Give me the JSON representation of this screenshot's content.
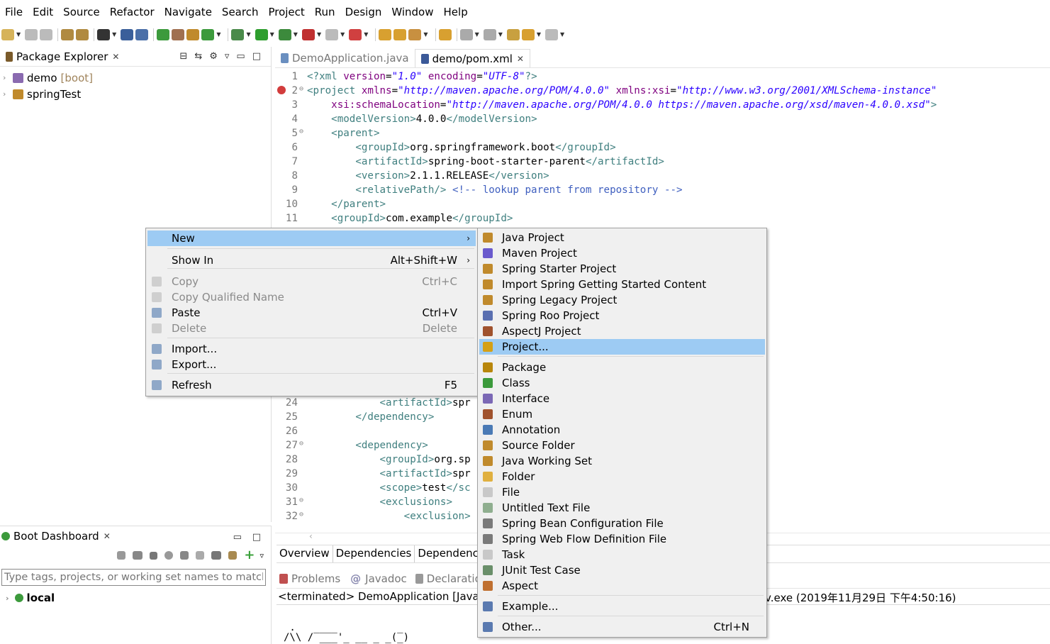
{
  "menubar": [
    "File",
    "Edit",
    "Source",
    "Refactor",
    "Navigate",
    "Search",
    "Project",
    "Run",
    "Design",
    "Window",
    "Help"
  ],
  "package_explorer": {
    "title": "Package Explorer",
    "items": [
      {
        "name": "demo",
        "tag": "[boot]"
      },
      {
        "name": "springTest",
        "tag": ""
      }
    ]
  },
  "editor": {
    "tabs": [
      "DemoApplication.java",
      "demo/pom.xml"
    ],
    "bottom_tabs": [
      "Overview",
      "Dependencies",
      "Dependency"
    ],
    "lines_top": [
      {
        "n": "1",
        "segs": [
          [
            "t",
            "<?xml "
          ],
          [
            "a",
            "version"
          ],
          [
            "p",
            "="
          ],
          [
            "v",
            "\"1.0\""
          ],
          [
            "p",
            " "
          ],
          [
            "a",
            "encoding"
          ],
          [
            "p",
            "="
          ],
          [
            "v",
            "\"UTF-8\""
          ],
          [
            "t",
            "?>"
          ]
        ]
      },
      {
        "n": "2",
        "segs": [
          [
            "t",
            "<project "
          ],
          [
            "a",
            "xmlns"
          ],
          [
            "p",
            "="
          ],
          [
            "v",
            "\"http://maven.apache.org/POM/4.0.0\""
          ],
          [
            "p",
            " "
          ],
          [
            "a",
            "xmlns:xsi"
          ],
          [
            "p",
            "="
          ],
          [
            "v",
            "\"http://www.w3.org/2001/XMLSchema-instance\""
          ]
        ]
      },
      {
        "n": "3",
        "segs": [
          [
            "p",
            "    "
          ],
          [
            "a",
            "xsi:schemaLocation"
          ],
          [
            "p",
            "="
          ],
          [
            "v",
            "\"http://maven.apache.org/POM/4.0.0 https://maven.apache.org/xsd/maven-4.0.0.xsd\""
          ],
          [
            "t",
            ">"
          ]
        ]
      },
      {
        "n": "4",
        "segs": [
          [
            "p",
            "    "
          ],
          [
            "t",
            "<modelVersion>"
          ],
          [
            "p",
            "4.0.0"
          ],
          [
            "t",
            "</modelVersion>"
          ]
        ]
      },
      {
        "n": "5",
        "segs": [
          [
            "p",
            "    "
          ],
          [
            "t",
            "<parent>"
          ]
        ]
      },
      {
        "n": "6",
        "segs": [
          [
            "p",
            "        "
          ],
          [
            "t",
            "<groupId>"
          ],
          [
            "p",
            "org.springframework.boot"
          ],
          [
            "t",
            "</groupId>"
          ]
        ]
      },
      {
        "n": "7",
        "segs": [
          [
            "p",
            "        "
          ],
          [
            "t",
            "<artifactId>"
          ],
          [
            "p",
            "spring-boot-starter-parent"
          ],
          [
            "t",
            "</artifactId>"
          ]
        ]
      },
      {
        "n": "8",
        "segs": [
          [
            "p",
            "        "
          ],
          [
            "t",
            "<version>"
          ],
          [
            "p",
            "2.1.1.RELEASE"
          ],
          [
            "t",
            "</version>"
          ]
        ]
      },
      {
        "n": "9",
        "segs": [
          [
            "p",
            "        "
          ],
          [
            "t",
            "<relativePath/>"
          ],
          [
            "p",
            " "
          ],
          [
            "c",
            "<!-- lookup parent from repository -->"
          ]
        ]
      },
      {
        "n": "10",
        "segs": [
          [
            "p",
            "    "
          ],
          [
            "t",
            "</parent>"
          ]
        ]
      },
      {
        "n": "11",
        "segs": [
          [
            "p",
            "    "
          ],
          [
            "t",
            "<groupId>"
          ],
          [
            "p",
            "com.example"
          ],
          [
            "t",
            "</groupId>"
          ]
        ]
      }
    ],
    "lines_bottom": [
      {
        "n": "24",
        "segs": [
          [
            "p",
            "            "
          ],
          [
            "t",
            "<artifactId>"
          ],
          [
            "p",
            "spr"
          ]
        ]
      },
      {
        "n": "25",
        "segs": [
          [
            "p",
            "        "
          ],
          [
            "t",
            "</dependency>"
          ]
        ]
      },
      {
        "n": "26",
        "segs": []
      },
      {
        "n": "27",
        "segs": [
          [
            "p",
            "        "
          ],
          [
            "t",
            "<dependency>"
          ]
        ]
      },
      {
        "n": "28",
        "segs": [
          [
            "p",
            "            "
          ],
          [
            "t",
            "<groupId>"
          ],
          [
            "p",
            "org.sp"
          ]
        ]
      },
      {
        "n": "29",
        "segs": [
          [
            "p",
            "            "
          ],
          [
            "t",
            "<artifactId>"
          ],
          [
            "p",
            "spr"
          ]
        ]
      },
      {
        "n": "30",
        "segs": [
          [
            "p",
            "            "
          ],
          [
            "t",
            "<scope>"
          ],
          [
            "p",
            "test"
          ],
          [
            "t",
            "</sc"
          ]
        ]
      },
      {
        "n": "31",
        "segs": [
          [
            "p",
            "            "
          ],
          [
            "t",
            "<exclusions>"
          ]
        ]
      },
      {
        "n": "32",
        "segs": [
          [
            "p",
            "                "
          ],
          [
            "t",
            "<exclusion>"
          ]
        ]
      }
    ]
  },
  "boot_dashboard": {
    "title": "Boot Dashboard",
    "filter_placeholder": "Type tags, projects, or working set names to match",
    "local_label": "local"
  },
  "console": {
    "tabs": [
      "Problems",
      "Javadoc",
      "Declaratio"
    ],
    "terminated_left": "<terminated> DemoApplication [Java A",
    "terminated_right": "v.exe (2019年11月29日 下午4:50:16)"
  },
  "context_menu": {
    "items": [
      {
        "label": "New",
        "accel": "",
        "submenu": true,
        "selected": true,
        "disabled": false,
        "icon": ""
      },
      {
        "label": "Show In",
        "accel": "Alt+Shift+W",
        "submenu": true,
        "selected": false,
        "disabled": false,
        "icon": ""
      },
      {
        "label": "Copy",
        "accel": "Ctrl+C",
        "disabled": true,
        "icon": "copy-icon"
      },
      {
        "label": "Copy Qualified Name",
        "accel": "",
        "disabled": true,
        "icon": "copy-qualified-name-icon"
      },
      {
        "label": "Paste",
        "accel": "Ctrl+V",
        "disabled": false,
        "icon": "paste-icon"
      },
      {
        "label": "Delete",
        "accel": "Delete",
        "disabled": true,
        "icon": "delete-icon"
      },
      {
        "label": "Import...",
        "accel": "",
        "disabled": false,
        "icon": "import-icon"
      },
      {
        "label": "Export...",
        "accel": "",
        "disabled": false,
        "icon": "export-icon"
      },
      {
        "label": "Refresh",
        "accel": "F5",
        "disabled": false,
        "icon": "refresh-icon"
      }
    ]
  },
  "new_submenu": {
    "items": [
      {
        "label": "Java Project",
        "icon": "java-project-icon",
        "color": "#c08a2c"
      },
      {
        "label": "Maven Project",
        "icon": "maven-project-icon",
        "color": "#6a5acd"
      },
      {
        "label": "Spring Starter Project",
        "icon": "spring-starter-icon",
        "color": "#c08a2c"
      },
      {
        "label": "Import Spring Getting Started Content",
        "icon": "spring-import-icon",
        "color": "#c08a2c"
      },
      {
        "label": "Spring Legacy Project",
        "icon": "spring-legacy-icon",
        "color": "#c08a2c"
      },
      {
        "label": "Spring Roo Project",
        "icon": "spring-roo-icon",
        "color": "#5a6fb0"
      },
      {
        "label": "AspectJ Project",
        "icon": "aspectj-project-icon",
        "color": "#a0522d"
      },
      {
        "label": "Project...",
        "icon": "project-icon",
        "color": "#d4a017",
        "selected": true
      },
      {
        "label": "Package",
        "icon": "package-icon",
        "color": "#b8860b"
      },
      {
        "label": "Class",
        "icon": "class-icon",
        "color": "#3c9a3c"
      },
      {
        "label": "Interface",
        "icon": "interface-icon",
        "color": "#7b68b5"
      },
      {
        "label": "Enum",
        "icon": "enum-icon",
        "color": "#a0522d"
      },
      {
        "label": "Annotation",
        "icon": "annotation-icon",
        "color": "#4a7ab5"
      },
      {
        "label": "Source Folder",
        "icon": "source-folder-icon",
        "color": "#c08a2c"
      },
      {
        "label": "Java Working Set",
        "icon": "working-set-icon",
        "color": "#c08a2c"
      },
      {
        "label": "Folder",
        "icon": "folder-icon",
        "color": "#e0b040"
      },
      {
        "label": "File",
        "icon": "file-icon",
        "color": "#c8c8c8"
      },
      {
        "label": "Untitled Text File",
        "icon": "text-file-icon",
        "color": "#8fae8f"
      },
      {
        "label": "Spring Bean Configuration File",
        "icon": "spring-bean-icon",
        "color": "#7a7a7a"
      },
      {
        "label": "Spring Web Flow Definition File",
        "icon": "web-flow-icon",
        "color": "#7a7a7a"
      },
      {
        "label": "Task",
        "icon": "task-icon",
        "color": "#c8c8c8"
      },
      {
        "label": "JUnit Test Case",
        "icon": "junit-icon",
        "color": "#6a8f6a"
      },
      {
        "label": "Aspect",
        "icon": "aspect-icon",
        "color": "#c07030"
      },
      {
        "label": "Example...",
        "icon": "example-icon",
        "color": "#5a7ab0"
      },
      {
        "label": "Other...",
        "accel": "Ctrl+N",
        "icon": "other-icon",
        "color": "#5a7ab0"
      }
    ]
  },
  "colors": {
    "selection": "#9dcbf3",
    "menu_bg": "#f0f0f0",
    "xml_tag": "#3f7f7f",
    "xml_attr": "#7f007f",
    "xml_value": "#2a00ff",
    "comment": "#3f5fbf"
  }
}
